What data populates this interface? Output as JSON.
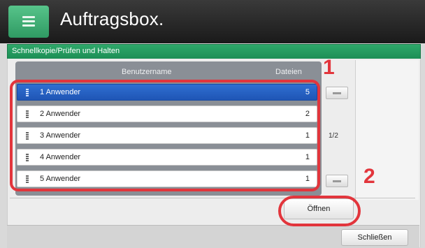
{
  "header": {
    "title": "Auftragsbox."
  },
  "section": {
    "label": "Schnellkopie/Prüfen und Halten"
  },
  "table": {
    "columns": {
      "user": "Benutzername",
      "files": "Dateien"
    },
    "rows": [
      {
        "name": "1 Anwender",
        "files": "5",
        "selected": true
      },
      {
        "name": "2 Anwender",
        "files": "2",
        "selected": false
      },
      {
        "name": "3 Anwender",
        "files": "1",
        "selected": false
      },
      {
        "name": "4 Anwender",
        "files": "1",
        "selected": false
      },
      {
        "name": "5 Anwender",
        "files": "1",
        "selected": false
      }
    ]
  },
  "pagination": {
    "indicator": "1/2"
  },
  "actions": {
    "open_label": "Öffnen",
    "close_label": "Schließen"
  },
  "callouts": {
    "one": "1",
    "two": "2"
  },
  "colors": {
    "accent_green": "#2ea86a",
    "selection_blue": "#2f6fd1",
    "callout_red": "#e2353c"
  },
  "icons": {
    "menu": "menu-icon",
    "scroll_up": "scroll-up-icon",
    "scroll_down": "scroll-down-icon"
  }
}
